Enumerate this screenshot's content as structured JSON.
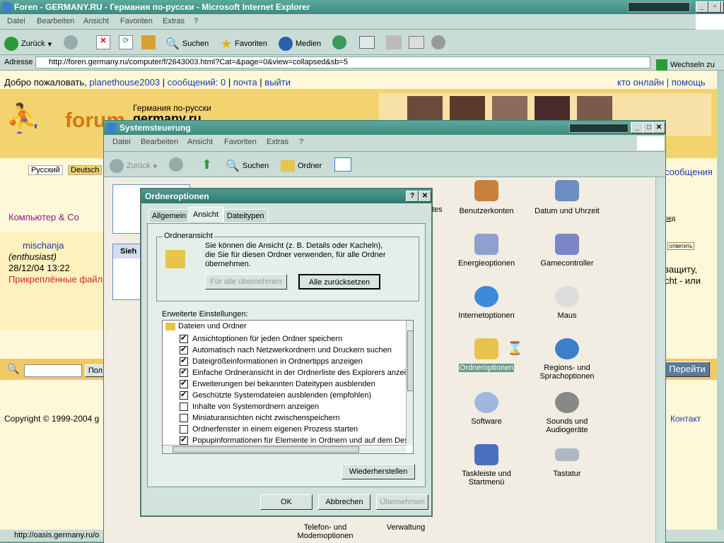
{
  "ie": {
    "title": "Foren - GERMANY.RU - Германия по-русски - Microsoft Internet Explorer",
    "menu": [
      "Datei",
      "Bearbeiten",
      "Ansicht",
      "Favoriten",
      "Extras",
      "?"
    ],
    "toolbar": {
      "back": "Zurück",
      "search": "Suchen",
      "favorites": "Favoriten",
      "media": "Medien"
    },
    "address_label": "Adresse",
    "url": "http://foren.germany.ru/computer/f/2643003.html?Cat=&page=0&view=collapsed&sb=5",
    "go": "Wechseln zu",
    "status": "http://oasis.germany.ru/o"
  },
  "page": {
    "welcome": "Добро пожаловать,",
    "user": "planethouse2003",
    "messages": "сообщений: 0",
    "mail": "почта",
    "logout": "выйти",
    "online": "кто онлайн",
    "help": "помощь",
    "logo": "forum",
    "tagline": "Германия по-русски",
    "site": "germany.ru",
    "lang_ru": "Русский",
    "lang_de": "Deutsch",
    "section": "Компьютер & Co",
    "msgs_link": "сообщения",
    "author": "mischanja",
    "rank": "(enthusiast)",
    "date": "28/12/04 13:22",
    "attached": "Прикреплённые файлы",
    "reply": "ответить",
    "body1": "защиту,",
    "body2": "cht - или",
    "go_btn": "Перейти",
    "search_btn": "Пол",
    "copyright": "Copyright © 1999-2004 g",
    "contact": "Контакт",
    "nav_btn": "ред"
  },
  "cp": {
    "title": "Systemsteuerung",
    "menu": [
      "Datei",
      "Bearbeiten",
      "Ansicht",
      "Favoriten",
      "Extras",
      "?"
    ],
    "toolbar": {
      "back": "Zurück",
      "search": "Suchen",
      "folders": "Ordner"
    },
    "side": "Sieh",
    "items": [
      {
        "label": "Benutzerkonten",
        "color": "#c9803c"
      },
      {
        "label": "Datum und Uhrzeit",
        "color": "#6d8cc4"
      },
      {
        "label": "Energieoptionen",
        "color": "#8fa0d0"
      },
      {
        "label": "Gamecontroller",
        "color": "#7a86c8"
      },
      {
        "label": "Internetoptionen",
        "color": "#3c8ad8"
      },
      {
        "label": "Maus",
        "color": "#dcdcdc"
      },
      {
        "label": "Ordneroptionen",
        "color": "#e8c44c"
      },
      {
        "label": "Regions- und Sprachoptionen",
        "color": "#3b7fcb"
      },
      {
        "label": "Software",
        "color": "#a0b8e0"
      },
      {
        "label": "Sounds und Audiogeräte",
        "color": "#888"
      },
      {
        "label": "Taskleiste und Startmenü",
        "color": "#4a70c0"
      },
      {
        "label": "Tastatur",
        "color": "#b0b8c8"
      },
      {
        "label": "Telefon- und Modemoptionen",
        "color": "#888"
      },
      {
        "label": "Verwaltung",
        "color": "#888"
      }
    ],
    "partial": "tes"
  },
  "dlg": {
    "title": "Ordneroptionen",
    "tabs": [
      "Allgemein",
      "Ansicht",
      "Dateitypen"
    ],
    "group": "Ordneransicht",
    "desc": "Sie können die Ansicht (z. B. Details oder Kacheln), die Sie für diesen Ordner verwenden, für alle Ordner übernehmen.",
    "apply_all": "Für alle übernehmen",
    "reset_all": "Alle zurücksetzen",
    "adv": "Erweiterte Einstellungen:",
    "tree_root": "Dateien und Ordner",
    "options": [
      {
        "label": "Ansichtoptionen für jeden Ordner speichern",
        "checked": true
      },
      {
        "label": "Automatisch nach Netzwerkordnern und Druckern suchen",
        "checked": true
      },
      {
        "label": "Dateigrößeinformationen in Ordnertipps anzeigen",
        "checked": true
      },
      {
        "label": "Einfache Ordneransicht in der Ordnerliste des Explorers anzeige",
        "checked": true
      },
      {
        "label": "Erweiterungen bei bekannten Dateitypen ausblenden",
        "checked": true
      },
      {
        "label": "Geschützte Systemdateien ausblenden (empfohlen)",
        "checked": true
      },
      {
        "label": "Inhalte von Systemordnern anzeigen",
        "checked": false
      },
      {
        "label": "Miniaturansichten nicht zwischenspeichern",
        "checked": false
      },
      {
        "label": "Ordnerfenster in einem eigenen Prozess starten",
        "checked": false
      },
      {
        "label": "Popupinformationen für Elemente in Ordnern und auf dem Deskt",
        "checked": true
      }
    ],
    "restore": "Wiederherstellen",
    "ok": "OK",
    "cancel": "Abbrechen",
    "apply": "Übernehmen"
  }
}
